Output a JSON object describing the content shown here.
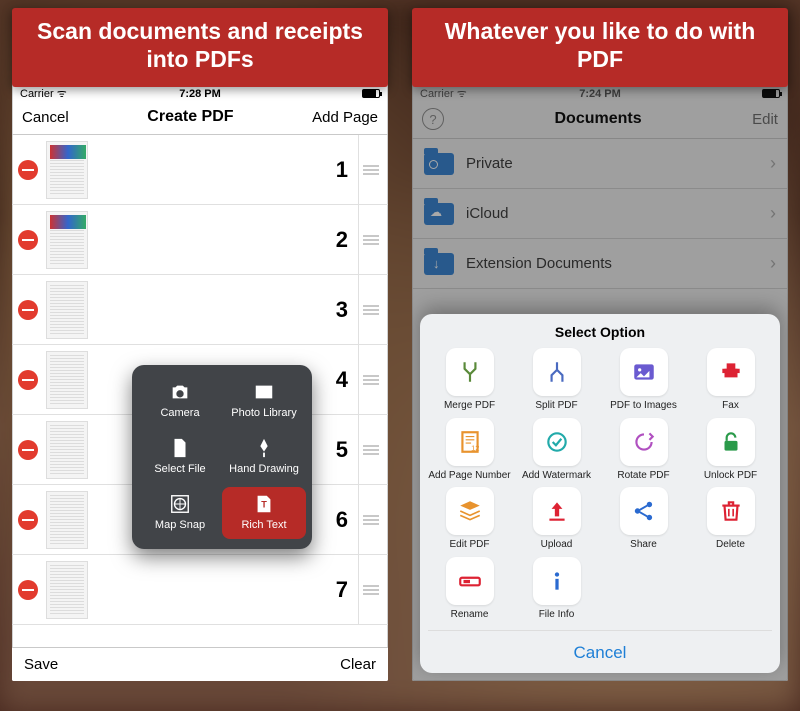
{
  "left": {
    "banner": "Scan documents and receipts into PDFs",
    "status": {
      "carrier": "Carrier",
      "time": "7:28 PM"
    },
    "nav": {
      "cancel": "Cancel",
      "title": "Create PDF",
      "add": "Add Page"
    },
    "pages": [
      "1",
      "2",
      "3",
      "4",
      "5",
      "6",
      "7"
    ],
    "popover": [
      {
        "label": "Camera"
      },
      {
        "label": "Photo Library"
      },
      {
        "label": "Select File"
      },
      {
        "label": "Hand Drawing"
      },
      {
        "label": "Map Snap"
      },
      {
        "label": "Rich Text",
        "selected": true
      }
    ],
    "toolbar": {
      "save": "Save",
      "clear": "Clear"
    }
  },
  "right": {
    "banner": "Whatever you like to do with PDF",
    "status": {
      "carrier": "Carrier",
      "time": "7:24 PM"
    },
    "nav": {
      "title": "Documents",
      "edit": "Edit"
    },
    "folders": [
      "Private",
      "iCloud",
      "Extension Documents"
    ],
    "sheet_title": "Select Option",
    "options": [
      "Merge PDF",
      "Split PDF",
      "PDF to Images",
      "Fax",
      "Add Page Number",
      "Add Watermark",
      "Rotate PDF",
      "Unlock PDF",
      "Edit PDF",
      "Upload",
      "Share",
      "Delete",
      "Rename",
      "File Info"
    ],
    "cancel": "Cancel"
  }
}
